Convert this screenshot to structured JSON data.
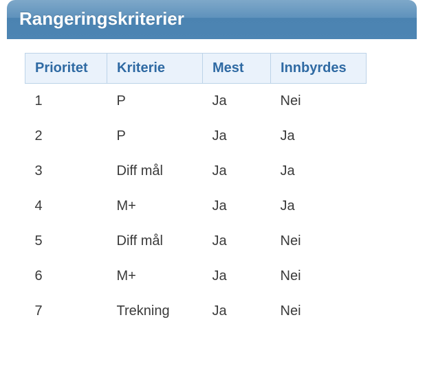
{
  "panel": {
    "title": "Rangeringskriterier"
  },
  "table": {
    "headers": {
      "prioritet": "Prioritet",
      "kriterie": "Kriterie",
      "mest": "Mest",
      "innbyrdes": "Innbyrdes"
    },
    "rows": [
      {
        "prioritet": "1",
        "kriterie": "P",
        "mest": "Ja",
        "innbyrdes": "Nei"
      },
      {
        "prioritet": "2",
        "kriterie": "P",
        "mest": "Ja",
        "innbyrdes": "Ja"
      },
      {
        "prioritet": "3",
        "kriterie": "Diff mål",
        "mest": "Ja",
        "innbyrdes": "Ja"
      },
      {
        "prioritet": "4",
        "kriterie": "M+",
        "mest": "Ja",
        "innbyrdes": "Ja"
      },
      {
        "prioritet": "5",
        "kriterie": "Diff mål",
        "mest": "Ja",
        "innbyrdes": "Nei"
      },
      {
        "prioritet": "6",
        "kriterie": "M+",
        "mest": "Ja",
        "innbyrdes": "Nei"
      },
      {
        "prioritet": "7",
        "kriterie": "Trekning",
        "mest": "Ja",
        "innbyrdes": "Nei"
      }
    ]
  }
}
